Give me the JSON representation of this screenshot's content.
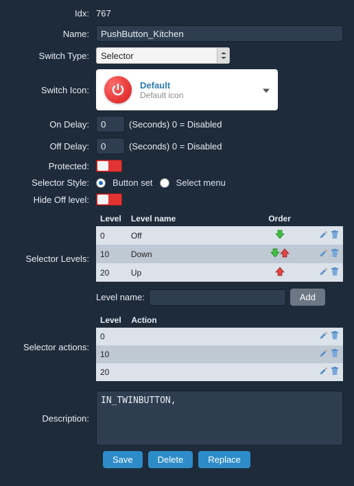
{
  "labels": {
    "idx": "Idx:",
    "name": "Name:",
    "switchType": "Switch Type:",
    "switchIcon": "Switch Icon:",
    "onDelay": "On Delay:",
    "offDelay": "Off Delay:",
    "protected": "Protected:",
    "selectorStyle": "Selector Style:",
    "hideOff": "Hide Off level:",
    "selectorLevels": "Selector Levels:",
    "selectorActions": "Selector actions:",
    "description": "Description:",
    "levelName": "Level name:"
  },
  "values": {
    "idx": "767",
    "name": "PushButton_Kitchen",
    "switchType": "Selector",
    "onDelay": "0",
    "offDelay": "0",
    "description": "IN_TWINBUTTON,"
  },
  "hints": {
    "delay": "(Seconds) 0 = Disabled"
  },
  "iconPicker": {
    "title": "Default",
    "subtitle": "Default icon"
  },
  "selectorStyle": {
    "opt1": "Button set",
    "opt2": "Select menu"
  },
  "levelsTable": {
    "headers": {
      "level": "Level",
      "name": "Level name",
      "order": "Order"
    },
    "rows": [
      {
        "level": "0",
        "name": "Off",
        "down": true,
        "up": false
      },
      {
        "level": "10",
        "name": "Down",
        "down": true,
        "up": true
      },
      {
        "level": "20",
        "name": "Up",
        "down": false,
        "up": true
      }
    ]
  },
  "actionsTable": {
    "headers": {
      "level": "Level",
      "action": "Action"
    },
    "rows": [
      {
        "level": "0",
        "action": ""
      },
      {
        "level": "10",
        "action": ""
      },
      {
        "level": "20",
        "action": ""
      }
    ]
  },
  "buttons": {
    "add": "Add",
    "save": "Save",
    "delete": "Delete",
    "replace": "Replace"
  }
}
